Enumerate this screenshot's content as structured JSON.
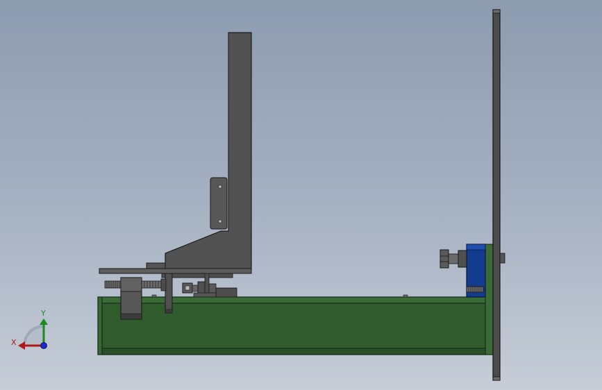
{
  "triad": {
    "x_label": "X",
    "y_label": "Y",
    "x_color": "#b01818",
    "y_color": "#1c8a1c",
    "z_color": "#1a2bd0"
  },
  "colors": {
    "background_top": "#8d9bb0",
    "background_bottom": "#c6cdd7",
    "frame_green": "#2e5a2c",
    "frame_green_edge": "#0f220f",
    "steel_gray": "#505050",
    "steel_edge": "#1c1c1c",
    "motor_blue": "#123a8c"
  }
}
